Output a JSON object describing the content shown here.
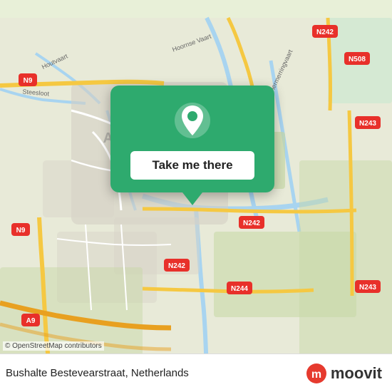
{
  "map": {
    "alt": "Map of Alkmaar area, Netherlands",
    "background_color": "#e8f0d8"
  },
  "popup": {
    "button_label": "Take me there",
    "icon": "location-pin"
  },
  "bottom_bar": {
    "location_name": "Bushalte Bestevearstraat, Netherlands",
    "logo_text": "moovit"
  },
  "copyright": {
    "text": "© OpenStreetMap contributors"
  },
  "road_labels": {
    "n9_top": "N9",
    "n242_top": "N242",
    "n508": "N508",
    "n9_left": "N9",
    "n242_mid": "N242",
    "n243_top": "N243",
    "n243_bottom": "N243",
    "n244": "N244",
    "a9_bottom": "A9"
  }
}
